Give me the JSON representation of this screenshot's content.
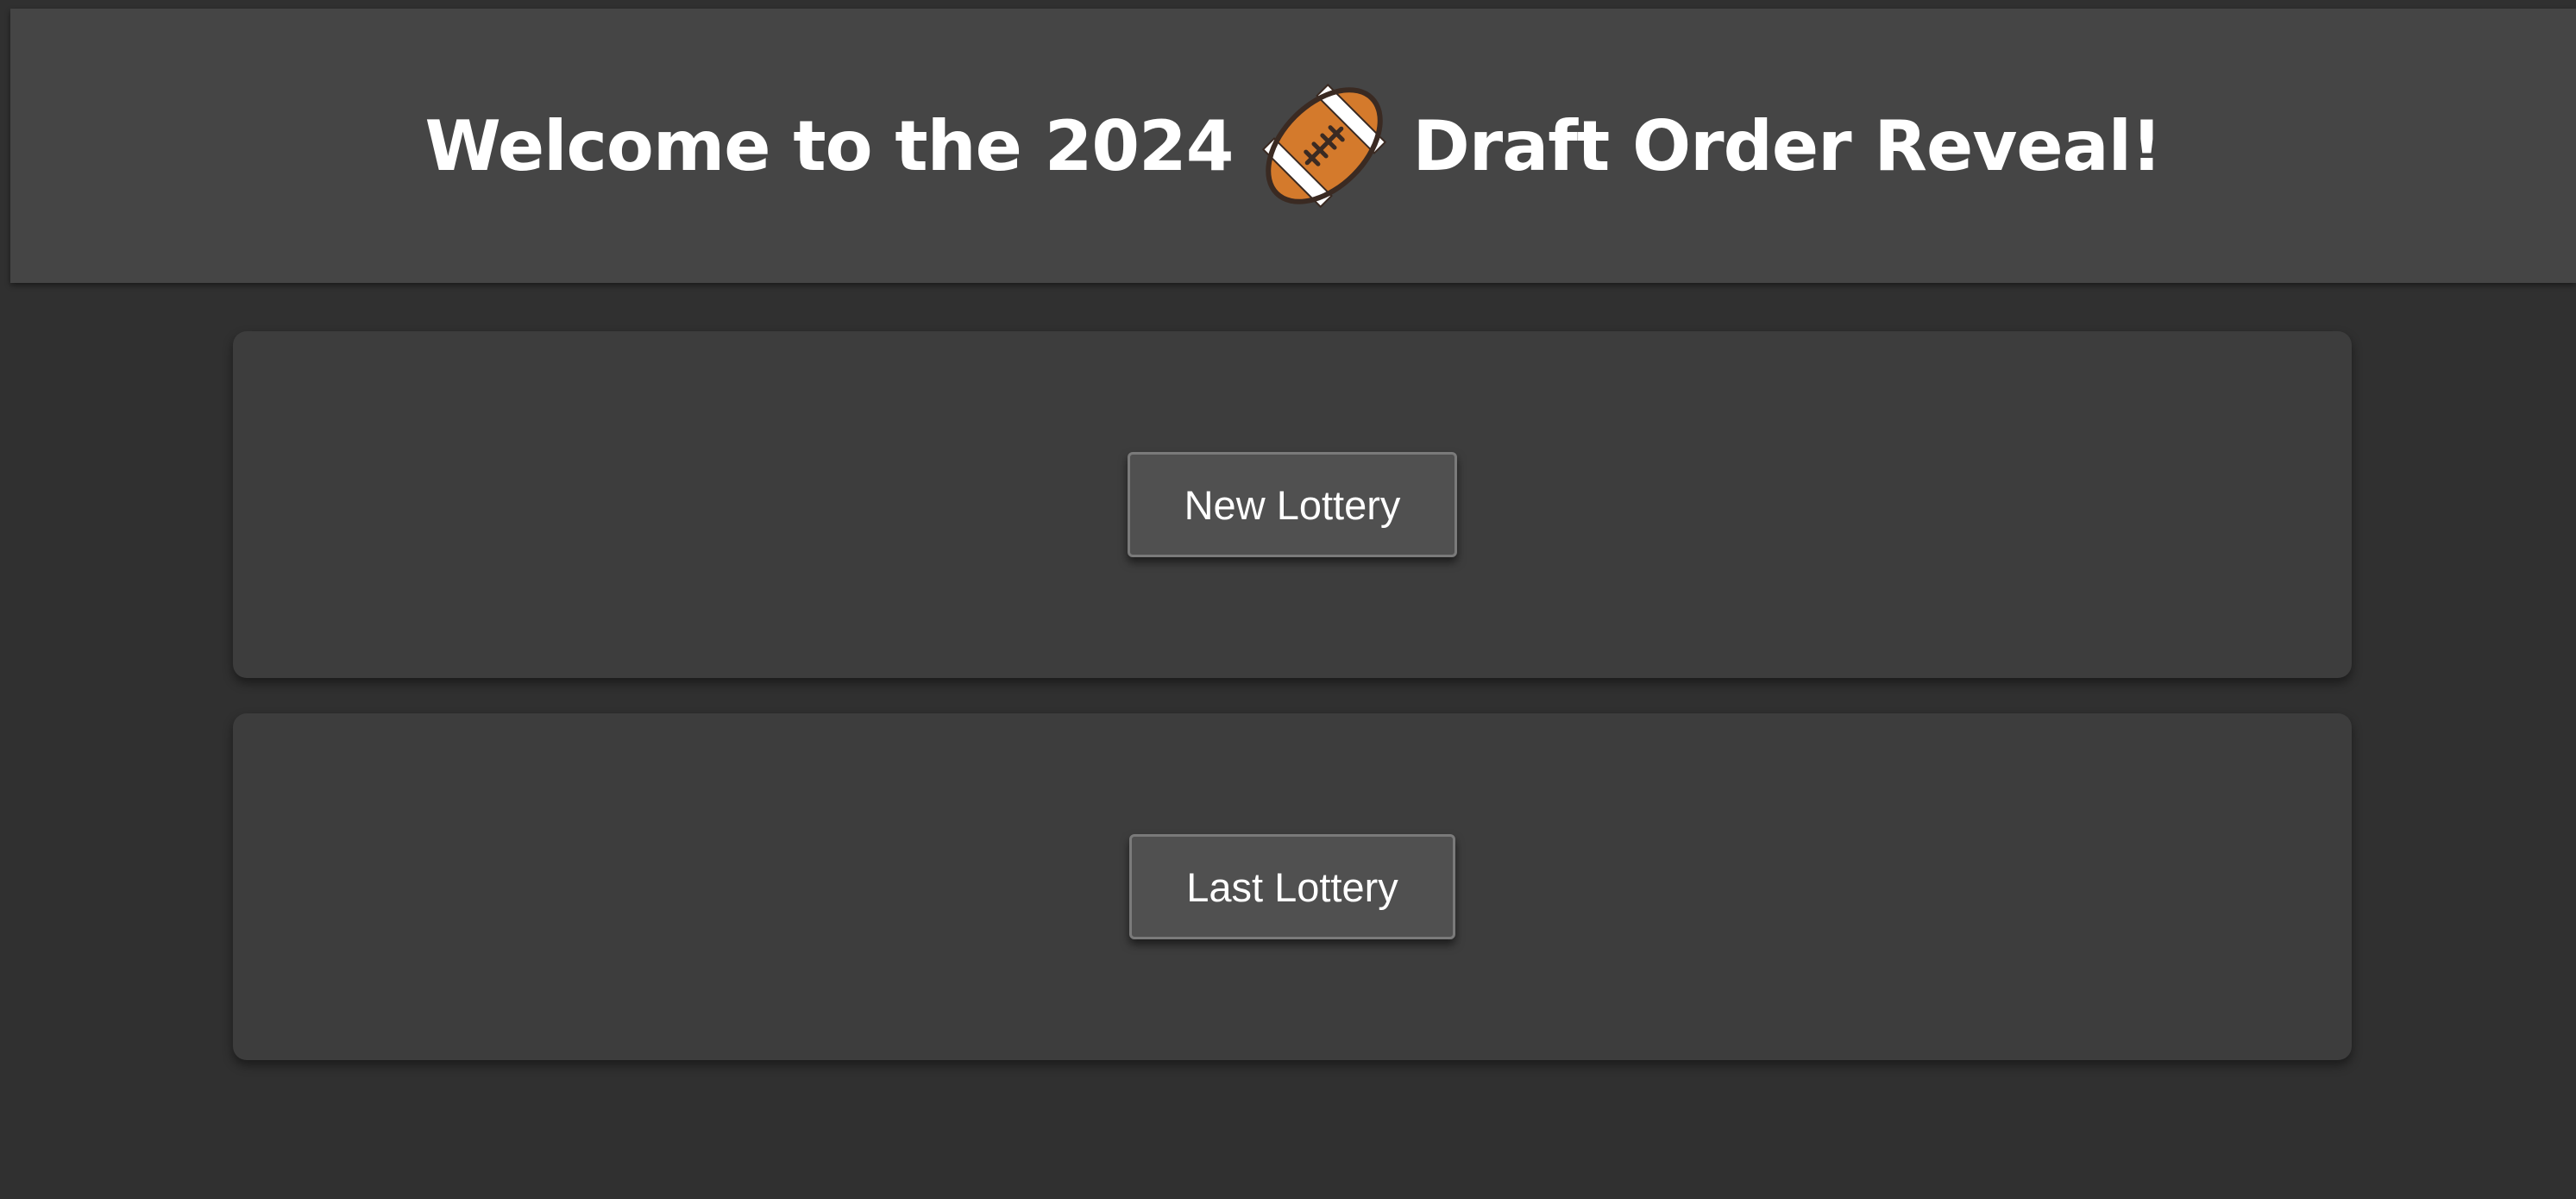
{
  "header": {
    "title_before": "Welcome to the 2024",
    "title_after": "Draft Order Reveal!",
    "icon": "football-icon"
  },
  "actions": {
    "new_lottery_label": "New Lottery",
    "last_lottery_label": "Last Lottery"
  },
  "colors": {
    "background": "#303030",
    "header_background": "#454545",
    "panel_background": "#3d3d3d",
    "button_background": "#505050",
    "button_border": "#7a7a7a",
    "text": "#ffffff",
    "football": "#d47a2c"
  }
}
